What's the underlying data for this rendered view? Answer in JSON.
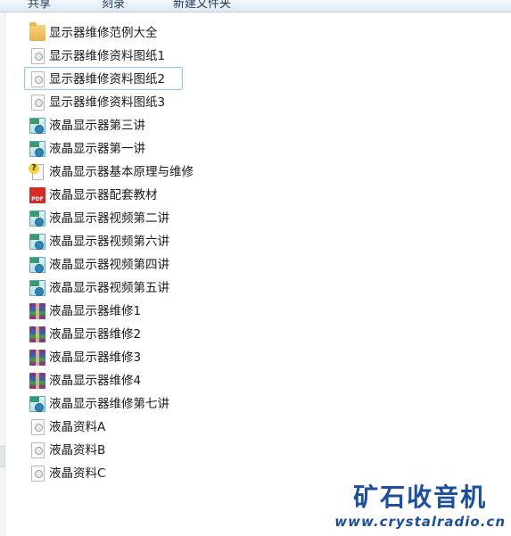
{
  "toolbar": {
    "items": [
      "共享",
      "刻录",
      "新建文件夹"
    ]
  },
  "files": [
    {
      "name": "显示器维修范例大全",
      "icon": "folder-icon"
    },
    {
      "name": "显示器维修资料图纸1",
      "icon": "document-icon"
    },
    {
      "name": "显示器维修资料图纸2",
      "icon": "document-icon",
      "selected": true
    },
    {
      "name": "显示器维修资料图纸3",
      "icon": "document-icon"
    },
    {
      "name": "液晶显示器第三讲",
      "icon": "video-file-icon"
    },
    {
      "name": "液晶显示器第一讲",
      "icon": "video-file-icon"
    },
    {
      "name": "液晶显示器基本原理与维修",
      "icon": "help-file-icon"
    },
    {
      "name": "液晶显示器配套教材",
      "icon": "pdf-file-icon"
    },
    {
      "name": "液晶显示器视频第二讲",
      "icon": "video-file-icon"
    },
    {
      "name": "液晶显示器视频第六讲",
      "icon": "video-file-icon"
    },
    {
      "name": "液晶显示器视频第四讲",
      "icon": "video-file-icon"
    },
    {
      "name": "液晶显示器视频第五讲",
      "icon": "video-file-icon"
    },
    {
      "name": "液晶显示器维修1",
      "icon": "rar-archive-icon"
    },
    {
      "name": "液晶显示器维修2",
      "icon": "rar-archive-icon"
    },
    {
      "name": "液晶显示器维修3",
      "icon": "rar-archive-icon"
    },
    {
      "name": "液晶显示器维修4",
      "icon": "rar-archive-icon"
    },
    {
      "name": "液晶显示器维修第七讲",
      "icon": "video-file-icon"
    },
    {
      "name": "液晶资料A",
      "icon": "document-icon"
    },
    {
      "name": "液晶资料B",
      "icon": "document-icon"
    },
    {
      "name": "液晶资料C",
      "icon": "document-icon"
    }
  ],
  "watermark": {
    "title": "矿石收音机",
    "url": "www.crystalradio.cn",
    "color": "#1d4fa0"
  },
  "colors": {
    "selection_border": "#9cc8f0",
    "toolbar_text": "#1e395b"
  }
}
